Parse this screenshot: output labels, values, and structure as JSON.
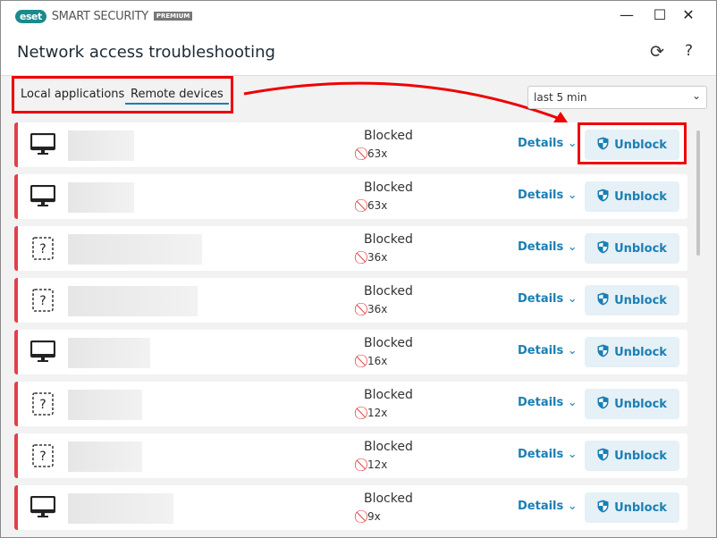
{
  "app": {
    "logo": "eset",
    "brand": "SMART SECURITY",
    "edition": "PREMIUM"
  },
  "window": {
    "minimize": "—",
    "maximize": "☐",
    "close": "✕"
  },
  "header": {
    "title": "Network access troubleshooting",
    "refresh_icon": "refresh-icon",
    "help": "?"
  },
  "tabs": [
    {
      "label": "Local applications",
      "active": false
    },
    {
      "label": "Remote devices",
      "active": true
    }
  ],
  "filter": {
    "value": "last 5 min"
  },
  "accent": "#1a7fb5",
  "blocked_color": "#e3404a",
  "rows": [
    {
      "icon": "monitor",
      "status": "Blocked",
      "count": "63x",
      "details": "Details",
      "action": "Unblock"
    },
    {
      "icon": "monitor",
      "status": "Blocked",
      "count": "63x",
      "details": "Details",
      "action": "Unblock"
    },
    {
      "icon": "unknown",
      "status": "Blocked",
      "count": "36x",
      "details": "Details",
      "action": "Unblock"
    },
    {
      "icon": "unknown",
      "status": "Blocked",
      "count": "36x",
      "details": "Details",
      "action": "Unblock"
    },
    {
      "icon": "monitor",
      "status": "Blocked",
      "count": "16x",
      "details": "Details",
      "action": "Unblock"
    },
    {
      "icon": "unknown",
      "status": "Blocked",
      "count": "12x",
      "details": "Details",
      "action": "Unblock"
    },
    {
      "icon": "unknown",
      "status": "Blocked",
      "count": "12x",
      "details": "Details",
      "action": "Unblock"
    },
    {
      "icon": "monitor",
      "status": "Blocked",
      "count": "9x",
      "details": "Details",
      "action": "Unblock"
    }
  ]
}
